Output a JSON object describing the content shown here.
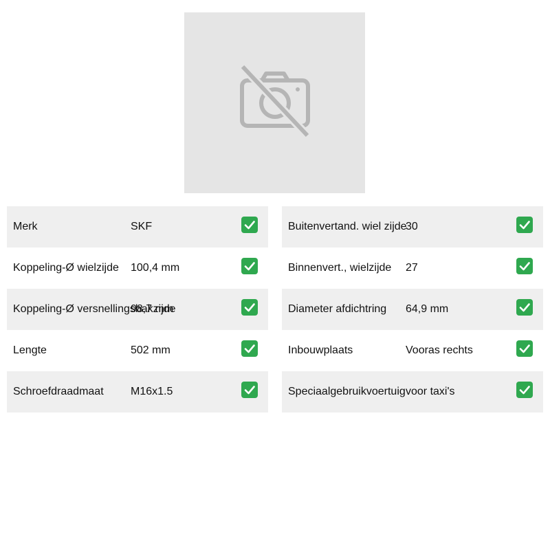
{
  "product_image": {
    "icon": "no-image-camera-icon"
  },
  "colors": {
    "placeholder_bg": "#e5e5e5",
    "placeholder_icon": "#b5b5b5",
    "row_shade": "#efefef",
    "check_green": "#2fa84f"
  },
  "specs_left": [
    {
      "label": "Merk",
      "value": "SKF"
    },
    {
      "label": "Koppeling-Ø wielzijde",
      "value": "100,4 mm"
    },
    {
      "label": "Koppeling-Ø versnellingsbakzijde",
      "value": "98,7 mm"
    },
    {
      "label": "Lengte",
      "value": "502 mm"
    },
    {
      "label": "Schroefdraadmaat",
      "value": "M16x1.5"
    }
  ],
  "specs_right": [
    {
      "label": "Buitenvertand. wiel zijde",
      "value": "30"
    },
    {
      "label": "Binnenvert., wielzijde",
      "value": "27"
    },
    {
      "label": "Diameter afdichtring",
      "value": "64,9 mm"
    },
    {
      "label": "Inbouwplaats",
      "value": "Vooras rechts"
    },
    {
      "label": "Speciaalgebruikvoertuig",
      "value": "voor taxi's"
    }
  ]
}
